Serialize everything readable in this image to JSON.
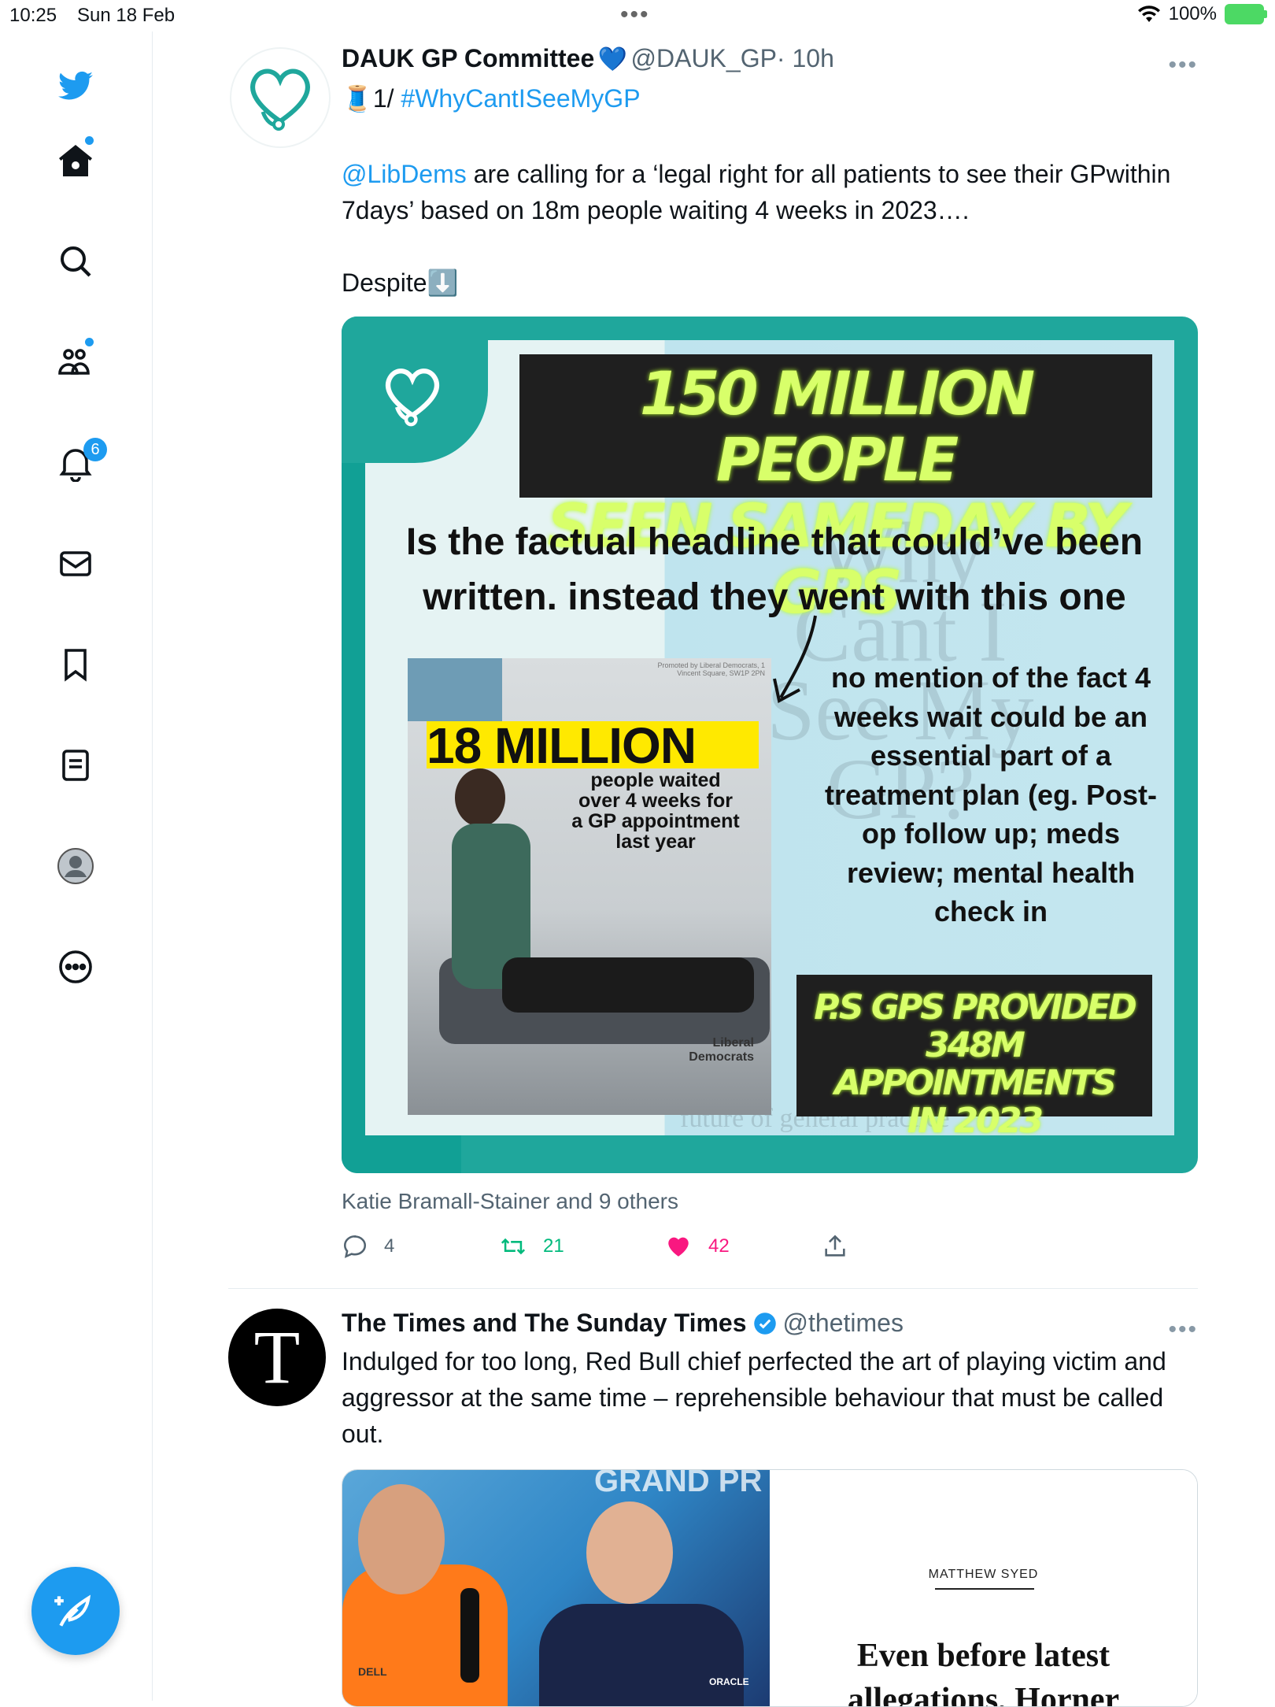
{
  "status_bar": {
    "time": "10:25",
    "date": "Sun 18 Feb",
    "battery": "100%"
  },
  "sidebar": {
    "notifications_count": "6"
  },
  "tweets": [
    {
      "author": "DAUK GP Committee",
      "verified_emoji": "💙",
      "handle": "@DAUK_GP",
      "time": "· 10h",
      "thread": "🧵1/ ",
      "hashtag": "#WhyCantISeeMyGP",
      "mention": "@LibDems",
      "text1": " are calling for a ‘legal right for all patients to see their GPwithin 7days’ based on 18m people waiting 4 weeks in 2023….",
      "text2": "Despite⬇️",
      "image": {
        "headline1": "150 MILLION PEOPLE",
        "headline2": "SEEN SAMEDAY BY GPS",
        "subtitle1": "Is the factual headline that could’ve been",
        "subtitle2": "written. instead they went with this one",
        "inset_big": "18 MILLION",
        "inset_small1": "people waited",
        "inset_small2": "over 4 weeks for",
        "inset_small3": "a GP appointment",
        "inset_small4": "last year",
        "inset_logo": "Liberal Democrats",
        "inset_promo": "Promoted by Liberal Democrats, 1 Vincent Square, SW1P 2PN",
        "note1": "no mention of the fact 4",
        "note2": "weeks wait could be an",
        "note3": "essential part of a",
        "note4": "treatment plan (eg. Post-",
        "note5": "op follow up; meds",
        "note6": "review; mental health",
        "note7": "check in",
        "ps1": "P.S GPS PROVIDED",
        "ps2": "348M APPOINTMENTS",
        "ps3": "IN 2023",
        "watermark1": "Why",
        "watermark2": "Cant I",
        "watermark3": "See My",
        "watermark4": "GP?",
        "watermark5": "future of general practice"
      },
      "liked_by": "Katie Bramall-Stainer and 9 others",
      "replies": "4",
      "retweets": "21",
      "likes": "42"
    },
    {
      "author": "The Times and The Sunday Times",
      "handle": "@thetimes",
      "avatar_letter": "T",
      "text": "Indulged for too long, Red Bull chief perfected the art of playing victim and aggressor at the same time – reprehensible behaviour that must be called out.",
      "card": {
        "byline": "MATTHEW SYED",
        "headline": "Even before latest",
        "headline2": "allegations, Horner",
        "banner": "GRAND PR",
        "sponsor": "DELL",
        "sponsor2": "ORACLE"
      }
    }
  ]
}
